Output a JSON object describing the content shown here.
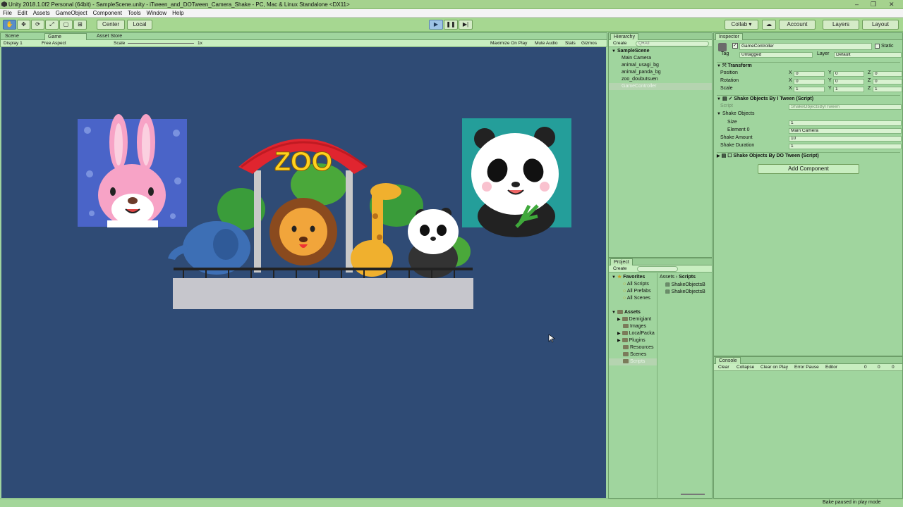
{
  "window": {
    "title": "Unity 2018.1.0f2 Personal (64bit) - SampleScene.unity - iTween_and_DOTween_Camera_Shake - PC, Mac & Linux Standalone <DX11>",
    "minimize": "–",
    "maximize": "❐",
    "close": "✕"
  },
  "menu": [
    "File",
    "Edit",
    "Assets",
    "GameObject",
    "Component",
    "Tools",
    "Window",
    "Help"
  ],
  "toolbar": {
    "tools": [
      "✋",
      "✥",
      "⟳",
      "⤢",
      "▢",
      "⊞"
    ],
    "pivot": "Center",
    "space": "Local",
    "play": "▶",
    "pause": "❚❚",
    "step": "▶|",
    "collab": "Collab ▾",
    "cloud": "☁",
    "account": "Account",
    "layers": "Layers",
    "layout": "Layout"
  },
  "game_panel": {
    "tabs": [
      "Scene",
      "Game",
      "Asset Store"
    ],
    "display": "Display 1",
    "aspect": "Free Aspect",
    "scale_label": "Scale",
    "scale_value": "1x",
    "options": [
      "Maximize On Play",
      "Mute Audio",
      "Stats",
      "Gizmos"
    ],
    "scene_text": "ZOO"
  },
  "hierarchy": {
    "tab": "Hierarchy",
    "create": "Create",
    "search_placeholder": "Q▾All",
    "scene": "SampleScene",
    "items": [
      "Main Camera",
      "animal_usagi_bg",
      "animal_panda_bg",
      "zoo_doubutsuen",
      "GameController"
    ],
    "selected_index": 4
  },
  "project": {
    "tab": "Project",
    "create": "Create",
    "favorites_label": "Favorites",
    "favorites": [
      "All Scripts",
      "All Prefabs",
      "All Scenes"
    ],
    "assets_label": "Assets",
    "folders": [
      "Demigiant",
      "Images",
      "LocalPacka",
      "Plugins",
      "Resources",
      "Scenes",
      "Scripts"
    ],
    "breadcrumb": [
      "Assets",
      "Scripts"
    ],
    "files": [
      "ShakeObjectsB",
      "ShakeObjectsB"
    ]
  },
  "inspector": {
    "tab": "Inspector",
    "object_name": "GameController",
    "static_label": "Static",
    "tag_label": "Tag",
    "tag_value": "Untagged",
    "layer_label": "Layer",
    "layer_value": "Default",
    "transform_label": "Transform",
    "transform_rows": [
      {
        "label": "Position",
        "x": "0",
        "y": "0",
        "z": "0"
      },
      {
        "label": "Rotation",
        "x": "0",
        "y": "0",
        "z": "0"
      },
      {
        "label": "Scale",
        "x": "1",
        "y": "1",
        "z": "1"
      }
    ],
    "component1": "Shake Objects By I Tween (Script)",
    "script_label": "Script",
    "script_value": "ShakeObjectsByITween",
    "shake_objects_label": "Shake Objects",
    "size_label": "Size",
    "size_value": "1",
    "element_label": "Element 0",
    "element_value": "Main Camera",
    "amount_label": "Shake Amount",
    "amount_value": "10",
    "duration_label": "Shake Duration",
    "duration_value": "1",
    "component2": "Shake Objects By DO Tween (Script)",
    "add_component": "Add Component"
  },
  "console": {
    "tab": "Console",
    "buttons": [
      "Clear",
      "Collapse",
      "Clear on Play",
      "Error Pause",
      "Editor"
    ],
    "counts": [
      "0",
      "0",
      "0"
    ]
  },
  "status": {
    "text": "Bake paused in play mode"
  },
  "colors": {
    "game_bg": "#2f4b75",
    "panel_bg": "#a0d59e",
    "toolbar_bg": "#a6d791",
    "play_active": "#9ec4e6"
  }
}
